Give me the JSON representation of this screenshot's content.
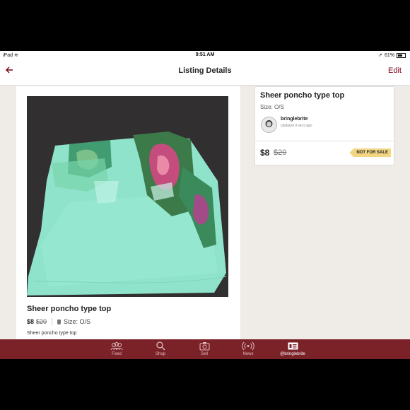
{
  "status_bar": {
    "device": "iPad",
    "time": "9:51 AM",
    "battery": "61%"
  },
  "nav": {
    "title": "Listing Details",
    "edit_label": "Edit",
    "back_icon": "back-arrow-icon"
  },
  "listing": {
    "title": "Sheer poncho type top",
    "price": "$8",
    "original_price": "$20",
    "size_label": "Size: O/S",
    "description": "Sheer poncho type top",
    "seller": "bringlebrite",
    "updated": "Updated 9 secs ago",
    "badge": "NOT FOR SALE"
  },
  "tabs": [
    {
      "label": "Feed",
      "icon": "people-icon"
    },
    {
      "label": "Shop",
      "icon": "search-icon"
    },
    {
      "label": "Sell",
      "icon": "camera-icon"
    },
    {
      "label": "News",
      "icon": "broadcast-icon"
    },
    {
      "label": "@bringlebrite",
      "icon": "profile-card-icon"
    }
  ],
  "colors": {
    "brand": "#7b2128",
    "accent": "#7f0019",
    "badge": "#f2d683",
    "background": "#efebe6"
  }
}
